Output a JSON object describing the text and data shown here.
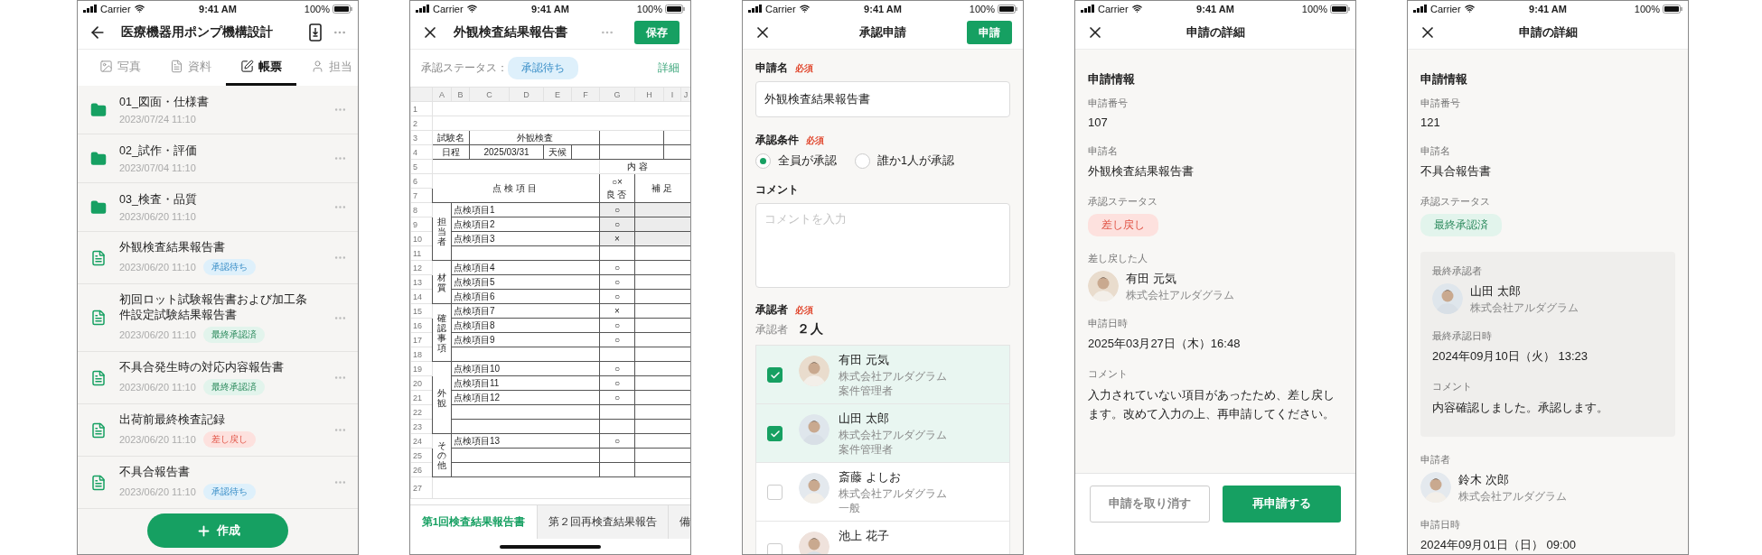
{
  "list_screen": {
    "status_bar": {
      "carrier": "Carrier",
      "time": "9:41 AM",
      "battery": "100%"
    },
    "title": "医療機器用ポンプ機構設計",
    "tabs": [
      {
        "label": "写真",
        "selected": false
      },
      {
        "label": "資料",
        "selected": false
      },
      {
        "label": "帳票",
        "selected": true
      },
      {
        "label": "担当",
        "selected": false
      }
    ],
    "items": [
      {
        "kind": "folder",
        "name": "01_図面・仕様書",
        "date": "2023/07/24 11:10"
      },
      {
        "kind": "folder",
        "name": "02_試作・評価",
        "date": "2023/07/04 11:10"
      },
      {
        "kind": "folder",
        "name": "03_検査・品質",
        "date": "2023/06/20 11:10"
      },
      {
        "kind": "document",
        "name": "外観検査結果報告書",
        "date": "2023/06/20 11:10",
        "tag": {
          "label": "承認待ち",
          "color": "#def0fb"
        }
      },
      {
        "kind": "document",
        "name": "初回ロット試験報告書および加工条件設定試験結果報告書",
        "date": "2023/06/20 11:10",
        "tag": {
          "label": "最終承認済",
          "color": "#e2f4ec"
        }
      },
      {
        "kind": "document",
        "name": "不具合発生時の対応内容報告書",
        "date": "2023/06/20 11:10",
        "tag": {
          "label": "最終承認済",
          "color": "#e2f4ec"
        }
      },
      {
        "kind": "document",
        "name": "出荷前最終検査記録",
        "date": "2023/06/20 11:10",
        "tag": {
          "label": "差し戻し",
          "color": "#fde1de"
        }
      },
      {
        "kind": "document",
        "name": "不具合報告書",
        "date": "2023/06/20 11:10",
        "tag": {
          "label": "承認待ち",
          "color": "#def0fb"
        }
      }
    ],
    "create_button": "作成"
  },
  "sheet_screen": {
    "status_bar": {
      "carrier": "Carrier",
      "time": "9:41 AM",
      "battery": "100%"
    },
    "title": "外観検査結果報告書",
    "save_button": "保存",
    "status_label": "承認ステータス：",
    "status_tag": {
      "label": "承認待ち",
      "color": "#def0fb"
    },
    "detail_link": "詳細",
    "sheet": {
      "columns": [
        "A",
        "B",
        "C",
        "D",
        "E",
        "F",
        "G",
        "H",
        "I",
        "J"
      ],
      "row_numbers": [
        "1",
        "2",
        "3",
        "4",
        "5",
        "6",
        "7",
        "8",
        "9",
        "10",
        "11",
        "12",
        "13",
        "14",
        "15",
        "16",
        "17",
        "18",
        "19",
        "20",
        "21",
        "22",
        "23",
        "24",
        "25",
        "26",
        "27"
      ],
      "header": {
        "test_name_label": "試験名",
        "test_name": "外観検査",
        "date_label": "日程",
        "date": "2025/03/31",
        "weather_label": "天候",
        "content_label": "内容",
        "item_header": "点検項目",
        "result_symbols": "○×",
        "result_header": "良否",
        "note_header": "補足"
      },
      "groups": [
        {
          "label": "担当者",
          "rows": [
            {
              "kind": "item",
              "name": "点検項目1",
              "result": "○",
              "shaded": true
            },
            {
              "kind": "item",
              "name": "点検項目2",
              "result": "○",
              "shaded": true
            },
            {
              "kind": "item",
              "name": "点検項目3",
              "result": "×",
              "shaded": true
            },
            {
              "kind": "blank"
            }
          ]
        },
        {
          "label": "材質",
          "rows": [
            {
              "kind": "item",
              "name": "点検項目4",
              "result": "○",
              "shaded": false
            },
            {
              "kind": "item",
              "name": "点検項目5",
              "result": "○",
              "shaded": false
            },
            {
              "kind": "item",
              "name": "点検項目6",
              "result": "○",
              "shaded": false
            }
          ]
        },
        {
          "label": "確認事項",
          "rows": [
            {
              "kind": "item",
              "name": "点検項目7",
              "result": "×",
              "shaded": false
            },
            {
              "kind": "item",
              "name": "点検項目8",
              "result": "○",
              "shaded": false
            },
            {
              "kind": "item",
              "name": "点検項目9",
              "result": "○",
              "shaded": false
            },
            {
              "kind": "blank"
            }
          ]
        },
        {
          "label": "外観",
          "rows": [
            {
              "kind": "item",
              "name": "点検項目10",
              "result": "○",
              "shaded": false
            },
            {
              "kind": "item",
              "name": "点検項目11",
              "result": "○",
              "shaded": false
            },
            {
              "kind": "item",
              "name": "点検項目12",
              "result": "○",
              "shaded": false
            },
            {
              "kind": "blank"
            },
            {
              "kind": "blank"
            }
          ]
        },
        {
          "label": "その他",
          "rows": [
            {
              "kind": "item",
              "name": "点検項目13",
              "result": "○",
              "shaded": false
            },
            {
              "kind": "blank"
            },
            {
              "kind": "blank"
            }
          ]
        }
      ]
    },
    "sheet_tabs": [
      {
        "label": "第1回検査結果報告書",
        "selected": true
      },
      {
        "label": "第２回再検査結果報告",
        "selected": false
      },
      {
        "label": "備",
        "selected": false
      }
    ]
  },
  "request_screen": {
    "status_bar": {
      "carrier": "Carrier",
      "time": "9:41 AM",
      "battery": "100%"
    },
    "title": "承認申請",
    "submit_button": "申請",
    "name_field": {
      "label": "申請名",
      "required": "必須",
      "value": "外観検査結果報告書"
    },
    "condition": {
      "label": "承認条件",
      "required": "必須",
      "options": [
        {
          "label": "全員が承認",
          "selected": true
        },
        {
          "label": "誰か1人が承認",
          "selected": false
        }
      ]
    },
    "comment": {
      "label": "コメント",
      "placeholder": "コメントを入力"
    },
    "approvers": {
      "label": "承認者",
      "required": "必須",
      "count_label": "承認者",
      "count": "２人",
      "people": [
        {
          "name": "有田 元気",
          "company": "株式会社アルダグラム",
          "role": "案件管理者",
          "checked": true
        },
        {
          "name": "山田 太郎",
          "company": "株式会社アルダグラム",
          "role": "案件管理者",
          "checked": true
        },
        {
          "name": "斎藤 よしお",
          "company": "株式会社アルダグラム",
          "role": "一般",
          "checked": false
        },
        {
          "name": "池上 花子",
          "checked": false
        }
      ]
    }
  },
  "returned_detail": {
    "status_bar": {
      "carrier": "Carrier",
      "time": "9:41 AM",
      "battery": "100%"
    },
    "title": "申請の詳細",
    "section": "申請情報",
    "fields": [
      {
        "kind": "text",
        "label": "申請番号",
        "value": "107"
      },
      {
        "kind": "text",
        "label": "申請名",
        "value": "外観検査結果報告書"
      },
      {
        "kind": "status",
        "label": "承認ステータス",
        "tag": {
          "label": "差し戻し",
          "color": "#fde1de"
        }
      },
      {
        "kind": "person",
        "label": "差し戻した人",
        "name": "有田 元気",
        "company": "株式会社アルダグラム"
      },
      {
        "kind": "text",
        "label": "申請日時",
        "value": "2025年03月27日（木）16:48"
      },
      {
        "kind": "paragraph",
        "label": "コメント",
        "value": "入力されていない項目があったため、差し戻します。改めて入力の上、再申請してください。"
      }
    ],
    "buttons": [
      {
        "label": "申請を取り消す",
        "kind": "secondary"
      },
      {
        "label": "再申請する",
        "kind": "primary"
      }
    ]
  },
  "approved_detail": {
    "status_bar": {
      "carrier": "Carrier",
      "time": "9:41 AM",
      "battery": "100%"
    },
    "title": "申請の詳細",
    "section": "申請情報",
    "fields": [
      {
        "kind": "text",
        "label": "申請番号",
        "value": "121"
      },
      {
        "kind": "text",
        "label": "申請名",
        "value": "不具合報告書"
      },
      {
        "kind": "status",
        "label": "承認ステータス",
        "tag": {
          "label": "最終承認済",
          "color": "#e2f4ec"
        }
      },
      {
        "kind": "card",
        "fields": [
          {
            "kind": "person",
            "label": "最終承認者",
            "name": "山田 太郎",
            "company": "株式会社アルダグラム"
          },
          {
            "kind": "text",
            "label": "最終承認日時",
            "value": "2024年09月10日（火） 13:23"
          },
          {
            "kind": "paragraph",
            "label": "コメント",
            "value": "内容確認しました。承認します。"
          }
        ]
      },
      {
        "kind": "person",
        "label": "申請者",
        "name": "鈴木 次郎",
        "company": "株式会社アルダグラム"
      },
      {
        "kind": "text",
        "label": "申請日時",
        "value": "2024年09月01日（日） 09:00"
      }
    ]
  }
}
